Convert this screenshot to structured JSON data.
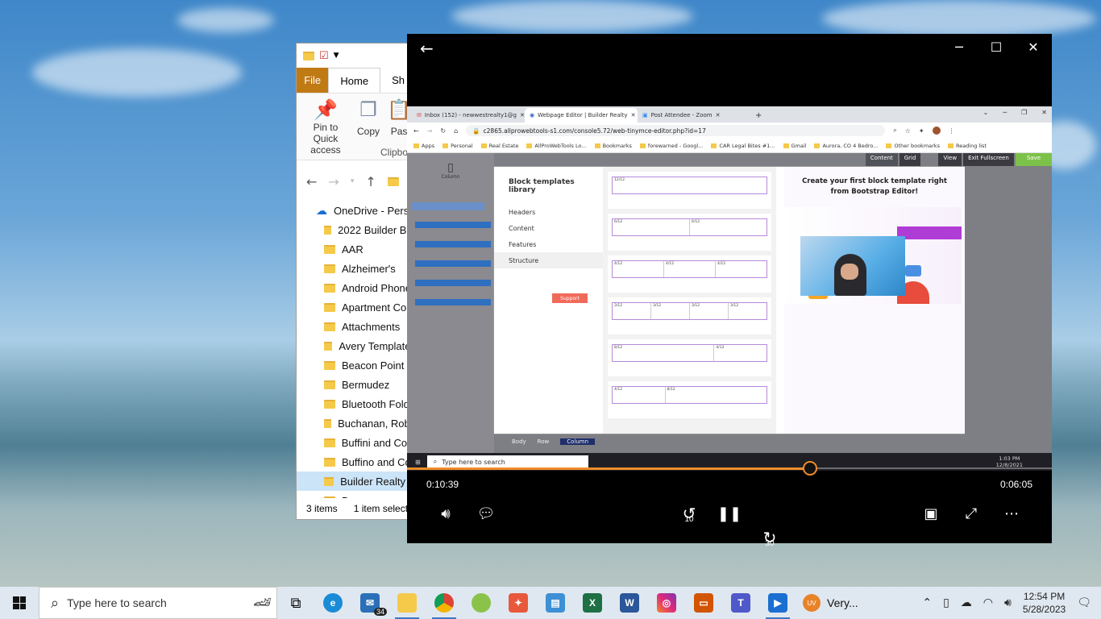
{
  "explorer": {
    "tabs": [
      "File",
      "Home",
      "Sh"
    ],
    "ribbon": [
      {
        "label": "Pin to Quick access",
        "icon": "pin-icon"
      },
      {
        "label": "Copy",
        "icon": "copy-icon"
      },
      {
        "label": "Pas",
        "icon": "paste-icon"
      }
    ],
    "ribbon_group": "Clipbo",
    "path": "«",
    "tree_root": "OneDrive - Person",
    "folders": [
      "2022 Builder Bre",
      "AAR",
      "Alzheimer's",
      "Android Phone",
      "Apartment Com",
      "Attachments",
      "Avery Templates",
      "Beacon Point M",
      "Bermudez",
      "Bluetooth Folde",
      "Buchanan, Robe",
      "Buffini and Com",
      "Buffino and Co",
      "Builder Realty C",
      "Buyers"
    ],
    "selected_folder": "Builder Realty C",
    "status_items": "3 items",
    "status_selected": "1 item select"
  },
  "player": {
    "elapsed": "0:10:39",
    "remaining": "0:06:05",
    "progress": 0.625,
    "skip_back": "10",
    "skip_fwd": "30"
  },
  "video_chrome": {
    "tabs": [
      "Inbox (152) - newwestrealty1@g",
      "Webpage Editor | Builder Realty",
      "Post Attendee - Zoom"
    ],
    "url": "c2865.allprowebtools-s1.com/console5.72/web-tinymce-editor.php?id=17",
    "bookmarks": [
      "Apps",
      "Personal",
      "Real Estate",
      "AllProWebTools Lo...",
      "Bookmarks",
      "forewarned - Googl...",
      "CAR Legal Bites #1...",
      "Gmail",
      "Aurora, CO 4 Bedro...",
      "Other bookmarks",
      "Reading list"
    ]
  },
  "editor": {
    "topbar": [
      "Content",
      "Grid",
      "View",
      "Exit Fullscreen",
      "Save"
    ],
    "left_label": "Column",
    "modal_title": "Block templates library",
    "categories": [
      "Headers",
      "Content",
      "Features",
      "Structure"
    ],
    "selected_category": "Structure",
    "support_label": "Support",
    "headline": "Create your first block template right from Bootstrap Editor!",
    "templates": [
      [
        "12/12"
      ],
      [
        "6/12",
        "6/12"
      ],
      [
        "4/12",
        "4/12",
        "4/12"
      ],
      [
        "3/12",
        "3/12",
        "3/12",
        "3/12"
      ],
      [
        "8/12",
        "4/12"
      ],
      [
        "4/12",
        "8/12"
      ]
    ],
    "breadcrumbs": [
      "Body",
      "Row",
      "Column"
    ]
  },
  "video_taskbar": {
    "search": "Type here to search",
    "time": "1:03 PM",
    "date": "12/8/2021"
  },
  "taskbar": {
    "search_placeholder": "Type here to search",
    "mail_badge": "34",
    "weather": "Very...",
    "uv": "UV",
    "time": "12:54 PM",
    "date": "5/28/2023"
  },
  "colors": {
    "accent_orange": "#f08c2a",
    "explorer_file_tab": "#c07a14",
    "editor_save": "#7cc24a"
  }
}
